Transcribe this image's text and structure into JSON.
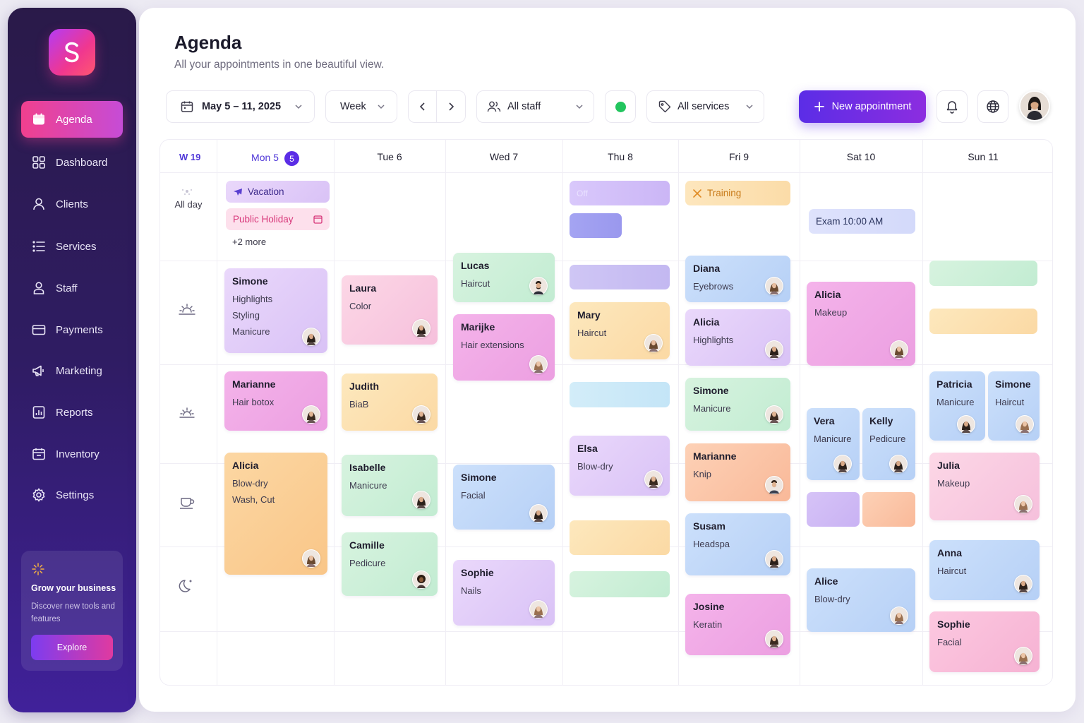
{
  "sidebar": {
    "items": [
      {
        "label": "Agenda",
        "icon": "calendar-icon",
        "active": true
      },
      {
        "label": "Dashboard",
        "icon": "grid-icon"
      },
      {
        "label": "Clients",
        "icon": "user-icon"
      },
      {
        "label": "Services",
        "icon": "list-icon"
      },
      {
        "label": "Staff",
        "icon": "staff-icon"
      },
      {
        "label": "Payments",
        "icon": "card-icon"
      },
      {
        "label": "Marketing",
        "icon": "megaphone-icon"
      },
      {
        "label": "Reports",
        "icon": "chart-icon"
      },
      {
        "label": "Inventory",
        "icon": "inventory-icon"
      },
      {
        "label": "Settings",
        "icon": "gear-icon"
      }
    ],
    "promo": {
      "title": "Grow your business",
      "text": "Discover new tools and features",
      "button": "Explore"
    }
  },
  "header": {
    "title": "Agenda",
    "subtitle": "All your appointments in one beautiful view."
  },
  "toolbar": {
    "date_range": "May 5 – 11, 2025",
    "view": "Week",
    "staff": "All staff",
    "services": "All services",
    "new_appointment": "New appointment",
    "status_color": "#22c55e"
  },
  "calendar": {
    "week": "W 19",
    "days": [
      "Mon 5",
      "Tue 6",
      "Wed 7",
      "Thu 8",
      "Fri 9",
      "Sat 10",
      "Sun 11"
    ],
    "today_badge": "5",
    "all_day_label": "All day",
    "all_day": {
      "mon_vacation": "Vacation",
      "mon_holiday": "Public Holiday",
      "mon_more": "+2 more",
      "thu_off": "Off",
      "fri_training": "Training",
      "sat_exam": "Exam 10:00 AM"
    },
    "events": {
      "mon_simone": {
        "name": "Simone",
        "services": [
          "Highlights",
          "Styling",
          "Manicure"
        ]
      },
      "mon_marianne": {
        "name": "Marianne",
        "services": [
          "Hair botox"
        ]
      },
      "mon_alicia": {
        "name": "Alicia",
        "services": [
          "Blow-dry",
          "Wash, Cut"
        ]
      },
      "tue_laura": {
        "name": "Laura",
        "services": [
          "Color"
        ]
      },
      "tue_judith": {
        "name": "Judith",
        "services": [
          "BiaB"
        ]
      },
      "tue_isabelle": {
        "name": "Isabelle",
        "services": [
          "Manicure"
        ]
      },
      "tue_camille": {
        "name": "Camille",
        "services": [
          "Pedicure"
        ]
      },
      "wed_lucas": {
        "name": "Lucas",
        "services": [
          "Haircut"
        ]
      },
      "wed_marijke": {
        "name": "Marijke",
        "services": [
          "Hair extensions"
        ]
      },
      "wed_simone": {
        "name": "Simone",
        "services": [
          "Facial"
        ]
      },
      "wed_sophie": {
        "name": "Sophie",
        "services": [
          "Nails"
        ]
      },
      "thu_mary": {
        "name": "Mary",
        "services": [
          "Haircut"
        ]
      },
      "thu_elsa": {
        "name": "Elsa",
        "services": [
          "Blow-dry"
        ]
      },
      "fri_diana": {
        "name": "Diana",
        "services": [
          "Eyebrows"
        ]
      },
      "fri_alicia": {
        "name": "Alicia",
        "services": [
          "Highlights"
        ]
      },
      "fri_simone": {
        "name": "Simone",
        "services": [
          "Manicure"
        ]
      },
      "fri_marianne": {
        "name": "Marianne",
        "services": [
          "Knip"
        ]
      },
      "fri_susam": {
        "name": "Susam",
        "services": [
          "Headspa"
        ]
      },
      "fri_josine": {
        "name": "Josine",
        "services": [
          "Keratin"
        ]
      },
      "sat_alicia": {
        "name": "Alicia",
        "services": [
          "Makeup"
        ]
      },
      "sat_vera": {
        "name": "Vera",
        "services": [
          "Manicure"
        ]
      },
      "sat_kelly": {
        "name": "Kelly",
        "services": [
          "Pedicure"
        ]
      },
      "sat_alice": {
        "name": "Alice",
        "services": [
          "Blow-dry"
        ]
      },
      "sun_patricia": {
        "name": "Patricia",
        "services": [
          "Manicure"
        ]
      },
      "sun_simone": {
        "name": "Simone",
        "services": [
          "Haircut"
        ]
      },
      "sun_julia": {
        "name": "Julia",
        "services": [
          "Makeup"
        ]
      },
      "sun_anna": {
        "name": "Anna",
        "services": [
          "Haircut"
        ]
      },
      "sun_sophie": {
        "name": "Sophie",
        "services": [
          "Facial"
        ]
      }
    }
  }
}
